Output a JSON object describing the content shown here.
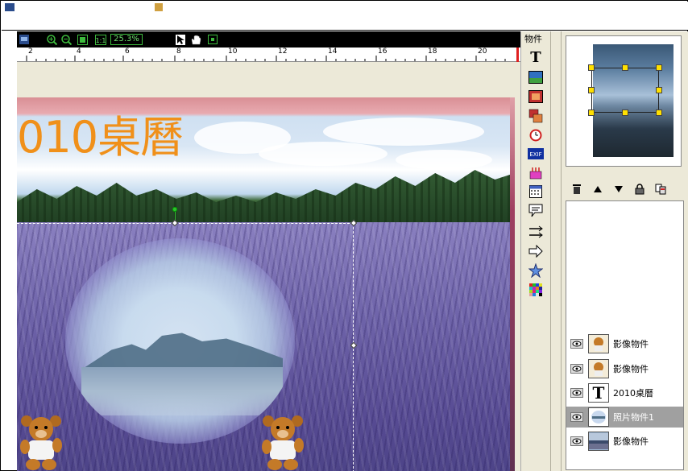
{
  "toolbar": {
    "zoom_level": "25.3%",
    "zoom_in_icon": "zoom-in-icon",
    "zoom_out_icon": "zoom-out-icon",
    "fit_icon": "fit-page-icon",
    "actual_size_label": "1:1",
    "tools": [
      "pointer-icon",
      "hand-pan-icon",
      "crop-icon"
    ]
  },
  "ruler": {
    "labels": [
      "2",
      "4",
      "6",
      "8",
      "10",
      "12",
      "14",
      "16",
      "18",
      "20"
    ]
  },
  "canvas": {
    "title_text": "010桌曆"
  },
  "object_panel": {
    "label": "物件",
    "tools": [
      "text-icon",
      "image-icon",
      "frame-icon",
      "overlap-icon",
      "clock-icon",
      "exif-icon",
      "cake-icon",
      "calendar-icon",
      "speech-bubble-icon",
      "arrows-icon",
      "arrow-right-icon",
      "star-icon",
      "mosaic-icon"
    ],
    "text_tool_label": "T",
    "exif_label": "EXIF"
  },
  "layers": {
    "toolbar": [
      "trash-icon",
      "move-up-icon",
      "move-down-icon",
      "lock-icon",
      "copy-icon"
    ],
    "items": [
      {
        "name": "影像物件",
        "thumb": "bear-thumbnail"
      },
      {
        "name": "影像物件",
        "thumb": "bear-thumbnail"
      },
      {
        "name": "2010桌曆",
        "thumb": "T"
      },
      {
        "name": "照片物件1",
        "thumb": "photo-thumbnail",
        "selected": true
      },
      {
        "name": "影像物件",
        "thumb": "landscape-thumbnail"
      }
    ]
  },
  "colors": {
    "accent_orange": "#f0901a",
    "handle_yellow": "#ffe000",
    "selected_layer": "#a0a0a0",
    "toolbar_bg": "#000000"
  }
}
